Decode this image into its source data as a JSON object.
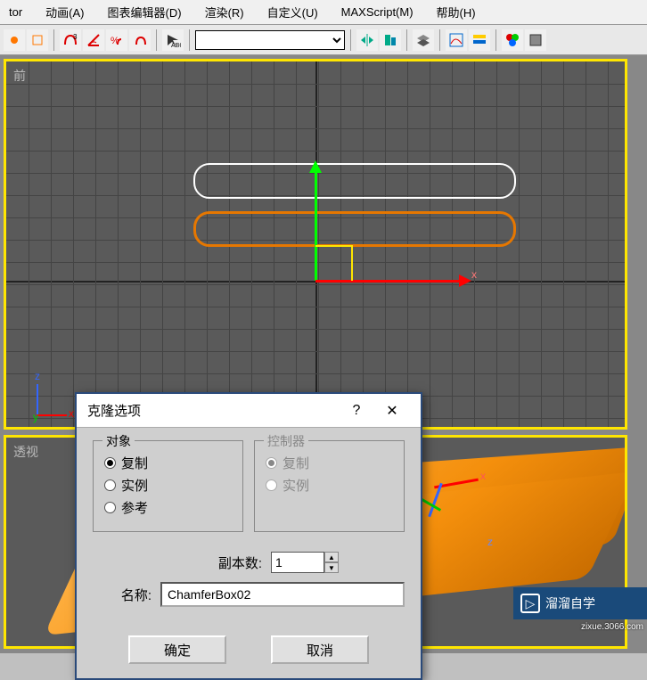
{
  "menu": {
    "items": [
      "tor",
      "动画(A)",
      "图表编辑器(D)",
      "渲染(R)",
      "自定义(U)",
      "MAXScript(M)",
      "帮助(H)"
    ]
  },
  "viewport": {
    "front_label": "前",
    "persp_label": "透视",
    "axes": {
      "x": "x",
      "y": "y",
      "z": "z"
    }
  },
  "dialog": {
    "title": "克隆选项",
    "help": "?",
    "close": "✕",
    "object_legend": "对象",
    "controller_legend": "控制器",
    "radio_copy": "复制",
    "radio_instance": "实例",
    "radio_reference": "参考",
    "copies_label": "副本数:",
    "copies_value": "1",
    "name_label": "名称:",
    "name_value": "ChamferBox02",
    "ok": "确定",
    "cancel": "取消"
  },
  "watermark": {
    "text": "溜溜自学",
    "sub": "zixue.3066.com"
  }
}
